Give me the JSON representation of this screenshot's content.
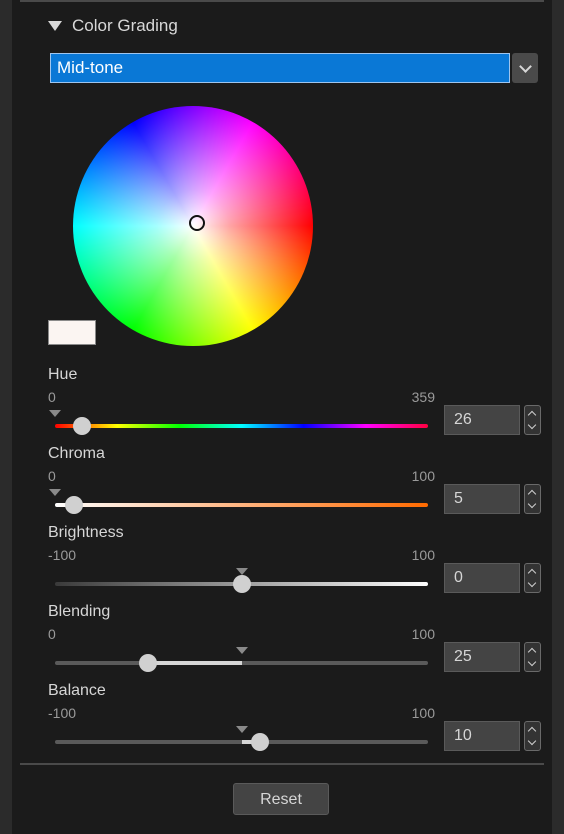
{
  "section": {
    "title": "Color Grading",
    "icon": "triangle-down-icon"
  },
  "tone_select": {
    "value": "Mid-tone",
    "icon": "chevron-down-icon"
  },
  "color_wheel": {
    "swatch_color": "#fbf5f2"
  },
  "sliders": [
    {
      "label": "Hue",
      "min": "0",
      "max": "359",
      "value": "26",
      "min_num": 0,
      "max_num": 359,
      "value_num": 26,
      "default_num": 0,
      "track": "hue"
    },
    {
      "label": "Chroma",
      "min": "0",
      "max": "100",
      "value": "5",
      "min_num": 0,
      "max_num": 100,
      "value_num": 5,
      "default_num": 0,
      "track": "chroma"
    },
    {
      "label": "Brightness",
      "min": "-100",
      "max": "100",
      "value": "0",
      "min_num": -100,
      "max_num": 100,
      "value_num": 0,
      "default_num": 0,
      "track": "bright"
    },
    {
      "label": "Blending",
      "min": "0",
      "max": "100",
      "value": "25",
      "min_num": 0,
      "max_num": 100,
      "value_num": 25,
      "default_num": 50,
      "track": "plain"
    },
    {
      "label": "Balance",
      "min": "-100",
      "max": "100",
      "value": "10",
      "min_num": -100,
      "max_num": 100,
      "value_num": 10,
      "default_num": 0,
      "track": "plain"
    }
  ],
  "reset_label": "Reset",
  "colors": {
    "accent": "#0a78d6",
    "background": "#1b1b1b",
    "thumb": "#d0d0d0"
  }
}
